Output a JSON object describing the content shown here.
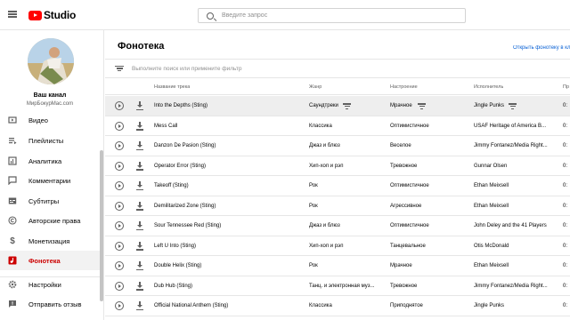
{
  "topbar": {
    "logo_text": "Studio",
    "search_placeholder": "Введите запрос"
  },
  "sidebar": {
    "channel_name": "Ваш канал",
    "channel_sub": "МирБокурMac.com",
    "items": [
      {
        "label": "Видео",
        "icon": "video-icon",
        "active": false
      },
      {
        "label": "Плейлисты",
        "icon": "playlist-icon",
        "active": false
      },
      {
        "label": "Аналитика",
        "icon": "analytics-icon",
        "active": false
      },
      {
        "label": "Комментарии",
        "icon": "comments-icon",
        "active": false
      },
      {
        "label": "Субтитры",
        "icon": "subtitles-icon",
        "active": false
      },
      {
        "label": "Авторские права",
        "icon": "copyright-icon",
        "active": false
      },
      {
        "label": "Монетизация",
        "icon": "dollar-icon",
        "active": false
      },
      {
        "label": "Фонотека",
        "icon": "audio-library-icon",
        "active": true
      },
      {
        "label": "Настройки",
        "icon": "gear-icon",
        "active": false
      },
      {
        "label": "Отправить отзыв",
        "icon": "feedback-icon",
        "active": false
      }
    ]
  },
  "main": {
    "title": "Фонотека",
    "open_link": "Открыть фонотеку в кл",
    "filter_placeholder": "Выполните поиск или примените фильтр",
    "columns": {
      "name": "Название трека",
      "genre": "Жанр",
      "mood": "Настроение",
      "artist": "Исполнитель",
      "more": "Пр"
    },
    "rows": [
      {
        "name": "Into the Depths (Sting)",
        "genre": "Саундтреки",
        "mood": "Мрачное",
        "artist": "Jingle Punks",
        "dur": "0:"
      },
      {
        "name": "Mess Call",
        "genre": "Классика",
        "mood": "Оптимистичное",
        "artist": "USAF Heritage of America B...",
        "dur": "0:"
      },
      {
        "name": "Danzon De Pasion (Sting)",
        "genre": "Джаз и блюз",
        "mood": "Веселое",
        "artist": "Jimmy Fontanez/Media Right...",
        "dur": "0:"
      },
      {
        "name": "Operator Error (Sting)",
        "genre": "Хип-хоп и рэп",
        "mood": "Тревожное",
        "artist": "Gunnar Olsen",
        "dur": "0:"
      },
      {
        "name": "Takeoff (Sting)",
        "genre": "Рок",
        "mood": "Оптимистичное",
        "artist": "Ethan Meixsell",
        "dur": "0:"
      },
      {
        "name": "Demilitarized Zone (Sting)",
        "genre": "Рок",
        "mood": "Агрессивное",
        "artist": "Ethan Meixsell",
        "dur": "0:"
      },
      {
        "name": "Sour Tennessee Red (Sting)",
        "genre": "Джаз и блюз",
        "mood": "Оптимистичное",
        "artist": "John Deley and the 41 Players",
        "dur": "0:"
      },
      {
        "name": "Left U Into (Sting)",
        "genre": "Хип-хоп и рэп",
        "mood": "Танцевальное",
        "artist": "Otis McDonald",
        "dur": "0:"
      },
      {
        "name": "Double Helix (Sting)",
        "genre": "Рок",
        "mood": "Мрачное",
        "artist": "Ethan Meixsell",
        "dur": "0:"
      },
      {
        "name": "Dub Hub (Sting)",
        "genre": "Танц. и электронная муз...",
        "mood": "Тревожное",
        "artist": "Jimmy Fontanez/Media Right...",
        "dur": "0:"
      },
      {
        "name": "Official National Anthem (Sting)",
        "genre": "Классика",
        "mood": "Приподнятое",
        "artist": "Jingle Punks",
        "dur": "0:"
      }
    ]
  },
  "colors": {
    "brand_red": "#ff0000",
    "active_red": "#cc0000",
    "link_blue": "#065fd4"
  }
}
